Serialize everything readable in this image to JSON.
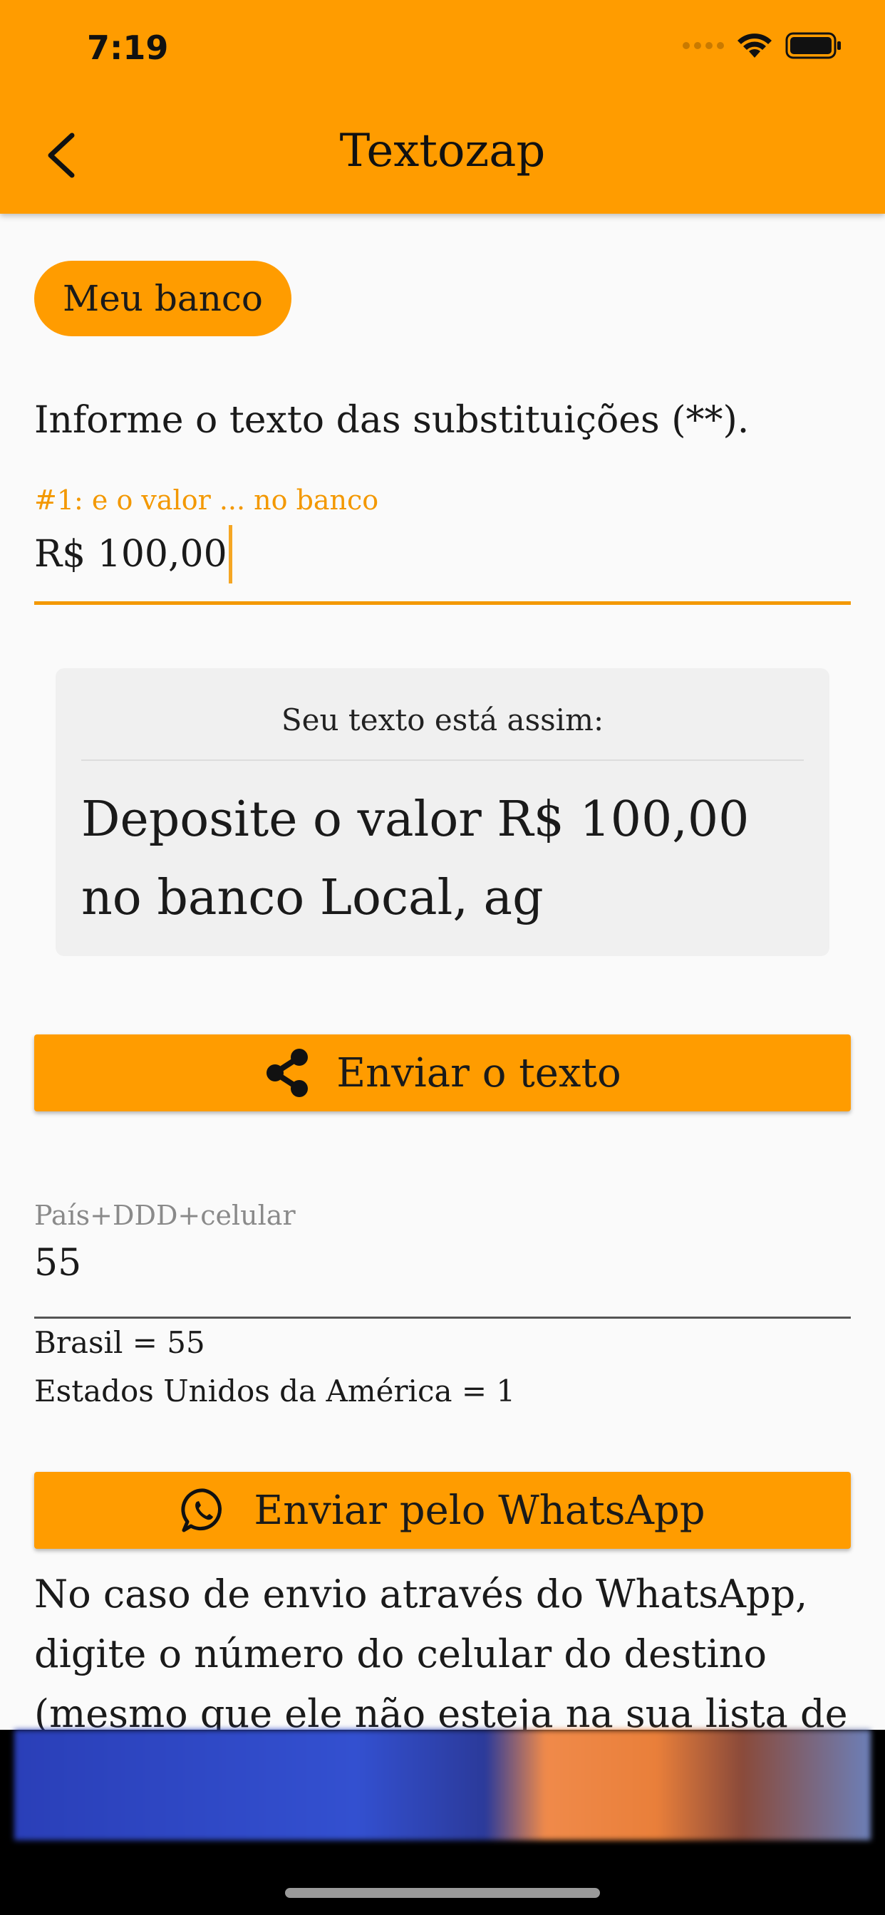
{
  "status_bar": {
    "time": "7:19"
  },
  "app_bar": {
    "title": "Textozap"
  },
  "chip": {
    "label": "Meu banco"
  },
  "instructions": "Informe o texto das substituições (**).",
  "substitution_field": {
    "label": "#1: e o valor ... no banco",
    "value": "R$ 100,00"
  },
  "preview": {
    "label": "Seu texto está assim:",
    "text": "Deposite o valor R$ 100,00 no banco Local, ag"
  },
  "send_button": {
    "label": "Enviar o texto",
    "icon": "share-icon"
  },
  "phone_field": {
    "label": "País+DDD+celular",
    "value": "55"
  },
  "country_codes": [
    "Brasil = 55",
    "Estados Unidos da América = 1"
  ],
  "whatsapp_button": {
    "label": "Enviar pelo WhatsApp",
    "icon": "whatsapp-icon"
  },
  "note": "No caso de envio através do WhatsApp, digite o número do celular do destino (mesmo que ele não esteja na sua lista de contatos).",
  "colors": {
    "accent": "#ff9c00",
    "label_active": "#f39800",
    "background": "#fafafa"
  }
}
